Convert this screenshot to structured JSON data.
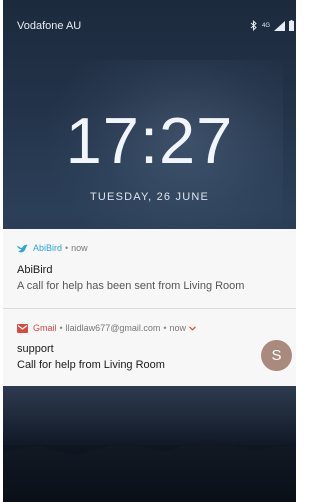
{
  "status_bar": {
    "carrier": "Vodafone AU",
    "network_label": "4G",
    "icons": [
      "bluetooth-icon",
      "signal-icon",
      "battery-icon"
    ]
  },
  "lock_screen": {
    "time": "17:27",
    "date": "TUESDAY, 26 JUNE"
  },
  "notifications": [
    {
      "app": "AbiBird",
      "icon": "bird-icon",
      "app_color": "#2aa8d8",
      "separator": "•",
      "time": "now",
      "title": "AbiBird",
      "text": "A call for help has been sent from Living Room"
    },
    {
      "app": "Gmail",
      "icon": "gmail-icon",
      "app_color": "#d94a3e",
      "separator": "•",
      "account": "llaidlaw677@gmail.com",
      "separator2": "•",
      "time": "now",
      "expand_icon": "chevron-down-icon",
      "title": "support",
      "text": "Call for help from Living Room",
      "avatar_letter": "S",
      "avatar_color": "#a98a7c"
    }
  ]
}
